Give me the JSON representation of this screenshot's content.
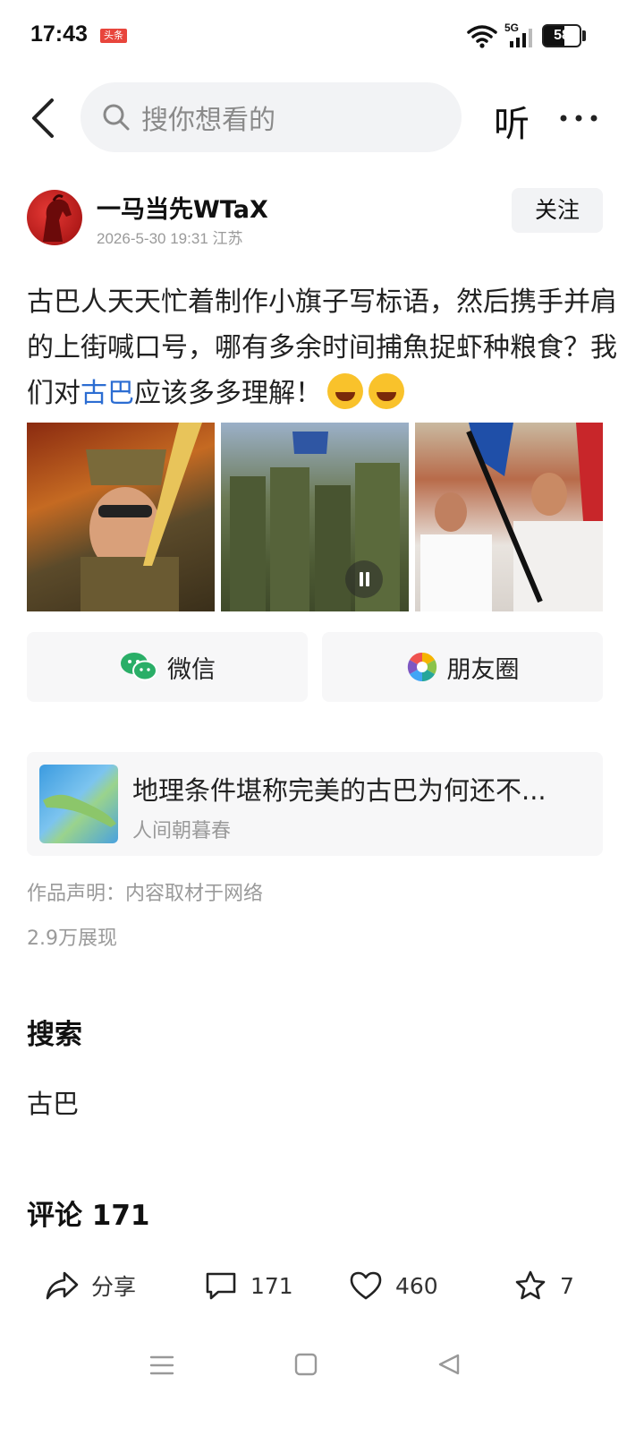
{
  "status_bar": {
    "time": "17:43",
    "app_badge": "头条",
    "network": "5G",
    "battery": "58",
    "battery_level": 0.58
  },
  "header": {
    "search_placeholder": "搜你想看的",
    "listen_label": "听"
  },
  "author": {
    "name": "一马当先WTaX",
    "meta": "2026-5-30 19:31 江苏",
    "follow_label": "关注"
  },
  "post": {
    "text_before": "古巴人天天忙着制作小旗子写标语，然后携手并肩的上街喊口号，哪有多余时间捕魚捉虾种粮食？我们对",
    "tag": "古巴",
    "text_after": "应该多多理解！"
  },
  "share": {
    "wechat_label": "微信",
    "moments_label": "朋友圈"
  },
  "linked_article": {
    "title": "地理条件堪称完美的古巴为何还不...",
    "source": "人间朝暮春"
  },
  "declaration": "作品声明：内容取材于网络",
  "views": "2.9万展现",
  "search_section": {
    "title": "搜索",
    "term": "古巴"
  },
  "comments_section": {
    "title": "评论 171"
  },
  "actions": {
    "share_label": "分享",
    "comments_count": "171",
    "likes_count": "460",
    "favorites_count": "7"
  },
  "colors": {
    "link_blue": "#2c6dd2",
    "wechat_green": "#2aae67",
    "badge_red": "#e8453c"
  }
}
